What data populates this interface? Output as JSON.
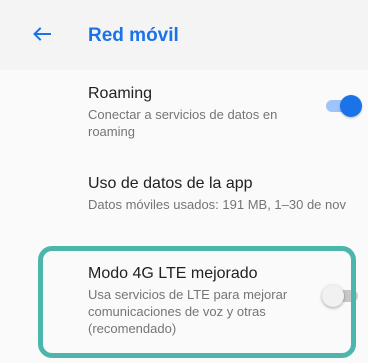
{
  "header": {
    "title": "Red móvil",
    "back_icon": "arrow-back-icon"
  },
  "settings": [
    {
      "title": "Roaming",
      "subtitle": "Conectar a servicios de datos en roaming",
      "switch_on": true
    },
    {
      "title": "Uso de datos de la app",
      "subtitle": "Datos móviles usados: 191 MB, 1–30 de nov"
    },
    {
      "title": "Modo 4G LTE mejorado",
      "subtitle": "Usa servicios de LTE para mejorar comunicaciones de voz y otras (recomendado)",
      "switch_on": false
    }
  ],
  "colors": {
    "accent": "#1a73e8",
    "highlight": "#4db6ac"
  }
}
